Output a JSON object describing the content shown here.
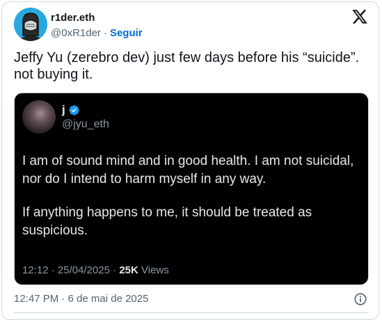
{
  "author": {
    "name": "r1der.eth",
    "handle": "@0xR1der",
    "separator": "·",
    "follow_label": "Seguir"
  },
  "tweet": {
    "text": "Jeffy Yu (zerebro dev) just few days before his “suicide”. not buying it.",
    "timestamp": "12:47 PM · 6 de mai de 2025"
  },
  "embedded": {
    "name": "j",
    "handle": "@jyu_eth",
    "paragraph_1": "I am of sound mind and in good health. I am not suicidal, nor do I intend to harm myself in any way.",
    "paragraph_2": "If anything happens to me, it should be treated as suspicious.",
    "time": "12:12",
    "date": "25/04/2025",
    "views_count": "25K",
    "views_label": "Views"
  },
  "icons": {
    "brand": "x-logo-icon",
    "verified": "verified-badge-icon",
    "info": "info-icon"
  },
  "colors": {
    "follow": "#006fd6",
    "avatar_bg": "#29a8e0",
    "verified": "#1d9bf0",
    "embed_bg": "#000000"
  }
}
